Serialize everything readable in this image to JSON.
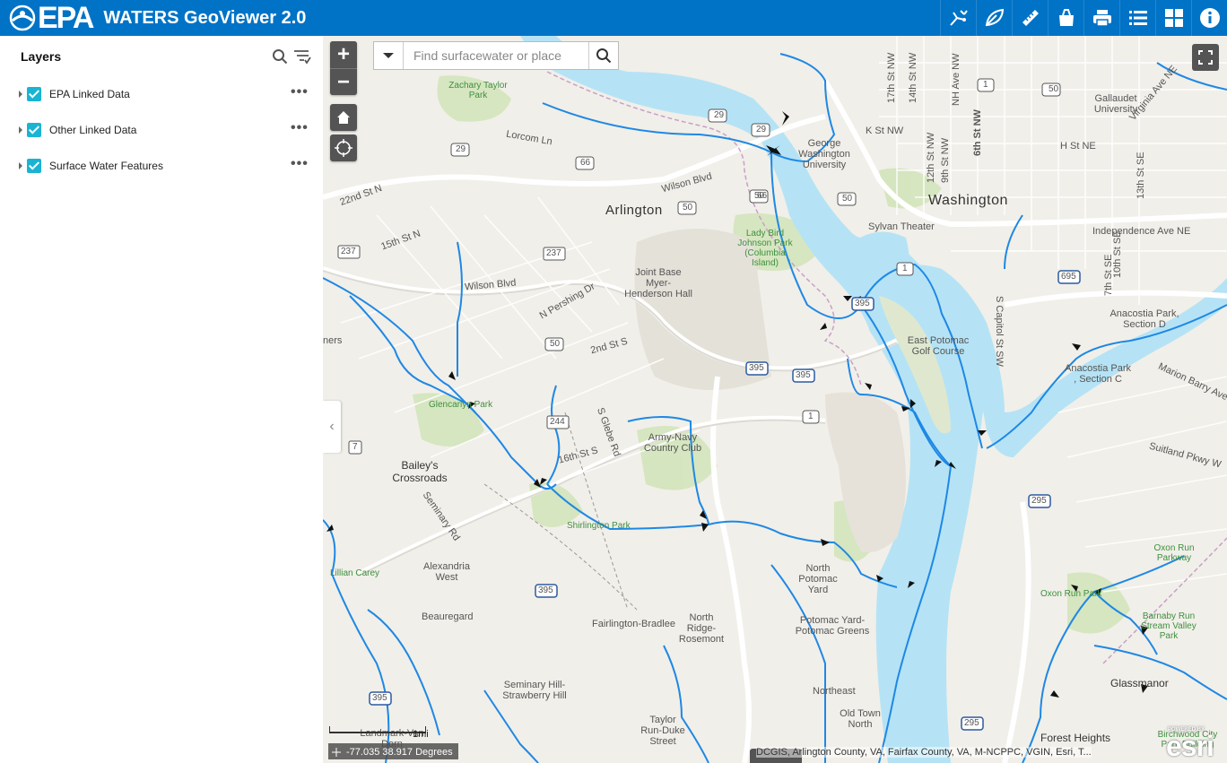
{
  "header": {
    "logo_text": "EPA",
    "title": "WATERS GeoViewer 2.0",
    "tools": [
      {
        "icon": "network-trace-icon"
      },
      {
        "icon": "watershed-icon"
      },
      {
        "icon": "ruler-icon"
      },
      {
        "icon": "bookmark-bag-icon"
      },
      {
        "icon": "printer-icon"
      },
      {
        "icon": "list-icon"
      },
      {
        "icon": "basemap-grid-icon"
      },
      {
        "icon": "info-icon"
      }
    ]
  },
  "sidebar": {
    "title": "Layers",
    "layers": [
      {
        "label": "EPA Linked Data",
        "checked": true
      },
      {
        "label": "Other Linked Data",
        "checked": true
      },
      {
        "label": "Surface Water Features",
        "checked": true
      }
    ]
  },
  "map": {
    "zoom_in": "+",
    "zoom_out": "−",
    "search_placeholder": "Find surfacewater or place",
    "scale_label": "1mi",
    "coordinates": "-77.035 38.917 Degrees",
    "attribution": "DCGIS, Arlington County, VA, Fairfax County, VA, M-NCPPC, VGIN, Esri, T...",
    "esri_powered": "POWERED BY",
    "esri_word": "esri",
    "colors": {
      "water": "#b5e3f5",
      "stream": "#1e88e5",
      "header": "#0073c6",
      "check": "#1ab4d3"
    },
    "labels": {
      "washington": "Washington",
      "arlington": "Arlington",
      "baileys": "Bailey's Crossroads",
      "joint_base": "Joint Base Myer-Henderson Hall",
      "gwu": "George Washington University",
      "gallaudet": "Gallaudet University",
      "sylvan": "Sylvan Theater",
      "east_potomac": "East Potomac Golf Course",
      "anacostia_c": "Anacostia Park , Section C",
      "anacostia_d": "Anacostia Park, Section D",
      "army_navy": "Army-Navy Country Club",
      "alexandria_west": "Alexandria West",
      "beauregard": "Beauregard",
      "fairlington": "Fairlington-Bradlee",
      "north_ridge": "North Ridge-Rosemont",
      "north_potomac": "North Potomac Yard",
      "potomac_greens": "Potomac Yard-Potomac Greens",
      "seminary": "Seminary Hill-Strawberry Hill",
      "northeast": "Northeast",
      "old_town": "Old Town North",
      "taylor": "Taylor Run-Duke Street",
      "forest_heights": "Forest Heights",
      "glassmanor": "Glassmanor",
      "landmark": "Landmark-Van Dorn",
      "zachary": "Zachary Taylor Park",
      "lady_bird": "Lady Bird Johnson Park (Columbia Island)",
      "glencarlyn": "Glencarlyn Park",
      "shirlington": "Shirlington Park",
      "lillian": "Lillian Carey",
      "oxon_run_pkwy": "Oxon Run Parkway",
      "oxon_run_park": "Oxon Run Park",
      "barnaby": "Barnaby Run Stream Valley Park",
      "birchwood": "Birchwood City Park Building",
      "ners": "ners",
      "k_st": "K St NW",
      "h_st": "H St NE",
      "independence": "Independence Ave NE",
      "marion_barry": "Marion Barry Ave",
      "suitland": "Suitland Pkwy W",
      "wilson": "Wilson Blvd",
      "wilson2": "Wilson Blvd",
      "lorcom": "Lorcom Ln",
      "n_pershing": "N Pershing Dr",
      "second_st": "2nd St S",
      "glebe": "S Glebe Rd",
      "sixteenth": "16th St S",
      "twentysecond": "22nd St N",
      "fifteenth": "15th St N",
      "seminary_rd": "Seminary Rd",
      "s_capitol": "S Capitol St SW",
      "seventh_se": "7th St SE",
      "tenth_se": "10th St SE",
      "thirteenth_se": "13th St SE",
      "seventeenth": "17th St NW",
      "fourteenth": "14th St NW",
      "nh_ave": "NH Ave NW",
      "sixth_st": "6th St NW",
      "twelfth": "12th St NW",
      "ninth": "9th St NW",
      "virginia_ne": "Virginia Ave NE",
      "i66a": "66",
      "i66b": "66",
      "us50a": "50",
      "us50b": "50",
      "us50c": "50",
      "us50d": "50",
      "us29a": "29",
      "us29b": "29",
      "us29c": "29",
      "r237a": "237",
      "r237b": "237",
      "r244": "244",
      "i395a": "395",
      "i395b": "395",
      "i395c": "395",
      "i395d": "395",
      "i395e": "395",
      "us1a": "1",
      "us1b": "1",
      "us1c": "1",
      "i695": "695",
      "i295a": "295",
      "i295b": "295",
      "r7": "7",
      "s1a": "1"
    }
  }
}
